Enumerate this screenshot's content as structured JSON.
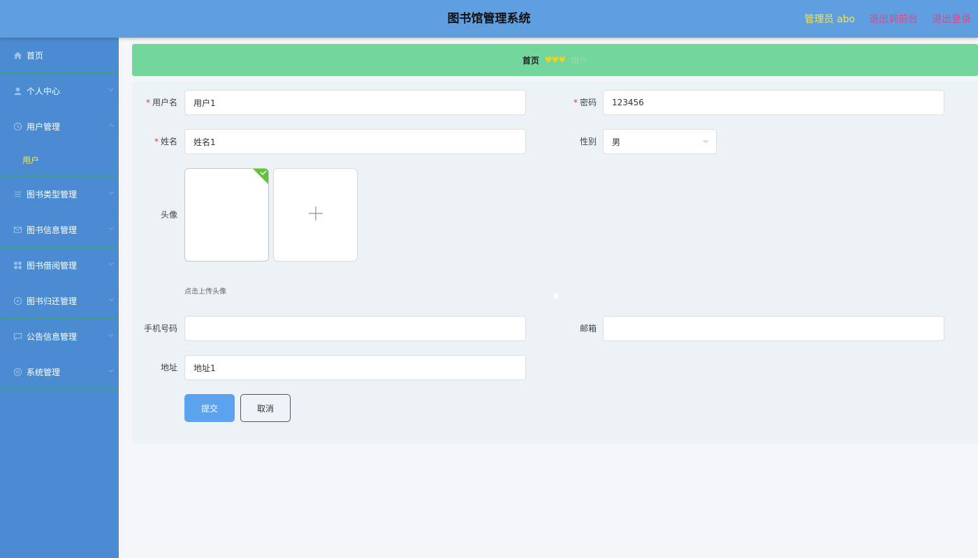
{
  "header": {
    "title": "图书馆管理系统",
    "admin_label": "管理员 abo",
    "back_to_front": "退出到前台",
    "logout": "退出登录"
  },
  "sidebar": {
    "items": [
      {
        "label": "首页",
        "icon": "home-icon"
      },
      {
        "label": "个人中心",
        "icon": "user-icon"
      },
      {
        "label": "用户管理",
        "icon": "clock-icon"
      },
      {
        "label": "图书类型管理",
        "icon": "list-icon"
      },
      {
        "label": "图书信息管理",
        "icon": "mail-icon"
      },
      {
        "label": "图书借阅管理",
        "icon": "grid-icon"
      },
      {
        "label": "图书归还管理",
        "icon": "compass-icon"
      },
      {
        "label": "公告信息管理",
        "icon": "chat-icon"
      },
      {
        "label": "系统管理",
        "icon": "settings-icon"
      }
    ],
    "sub_item": "用户"
  },
  "breadcrumb": {
    "home": "首页",
    "separator": "♥♥♥",
    "current": "用户"
  },
  "form": {
    "username": {
      "label": "用户名",
      "value": "用户1"
    },
    "password": {
      "label": "密码",
      "value": "123456"
    },
    "name": {
      "label": "姓名",
      "value": "姓名1"
    },
    "gender": {
      "label": "性别",
      "value": "男"
    },
    "avatar": {
      "label": "头像",
      "hint": "点击上传头像"
    },
    "phone": {
      "label": "手机号码",
      "value": ""
    },
    "email": {
      "label": "邮箱",
      "value": ""
    },
    "address": {
      "label": "地址",
      "value": "地址1"
    },
    "required_mark": "*",
    "submit": "提交",
    "cancel": "取消"
  }
}
